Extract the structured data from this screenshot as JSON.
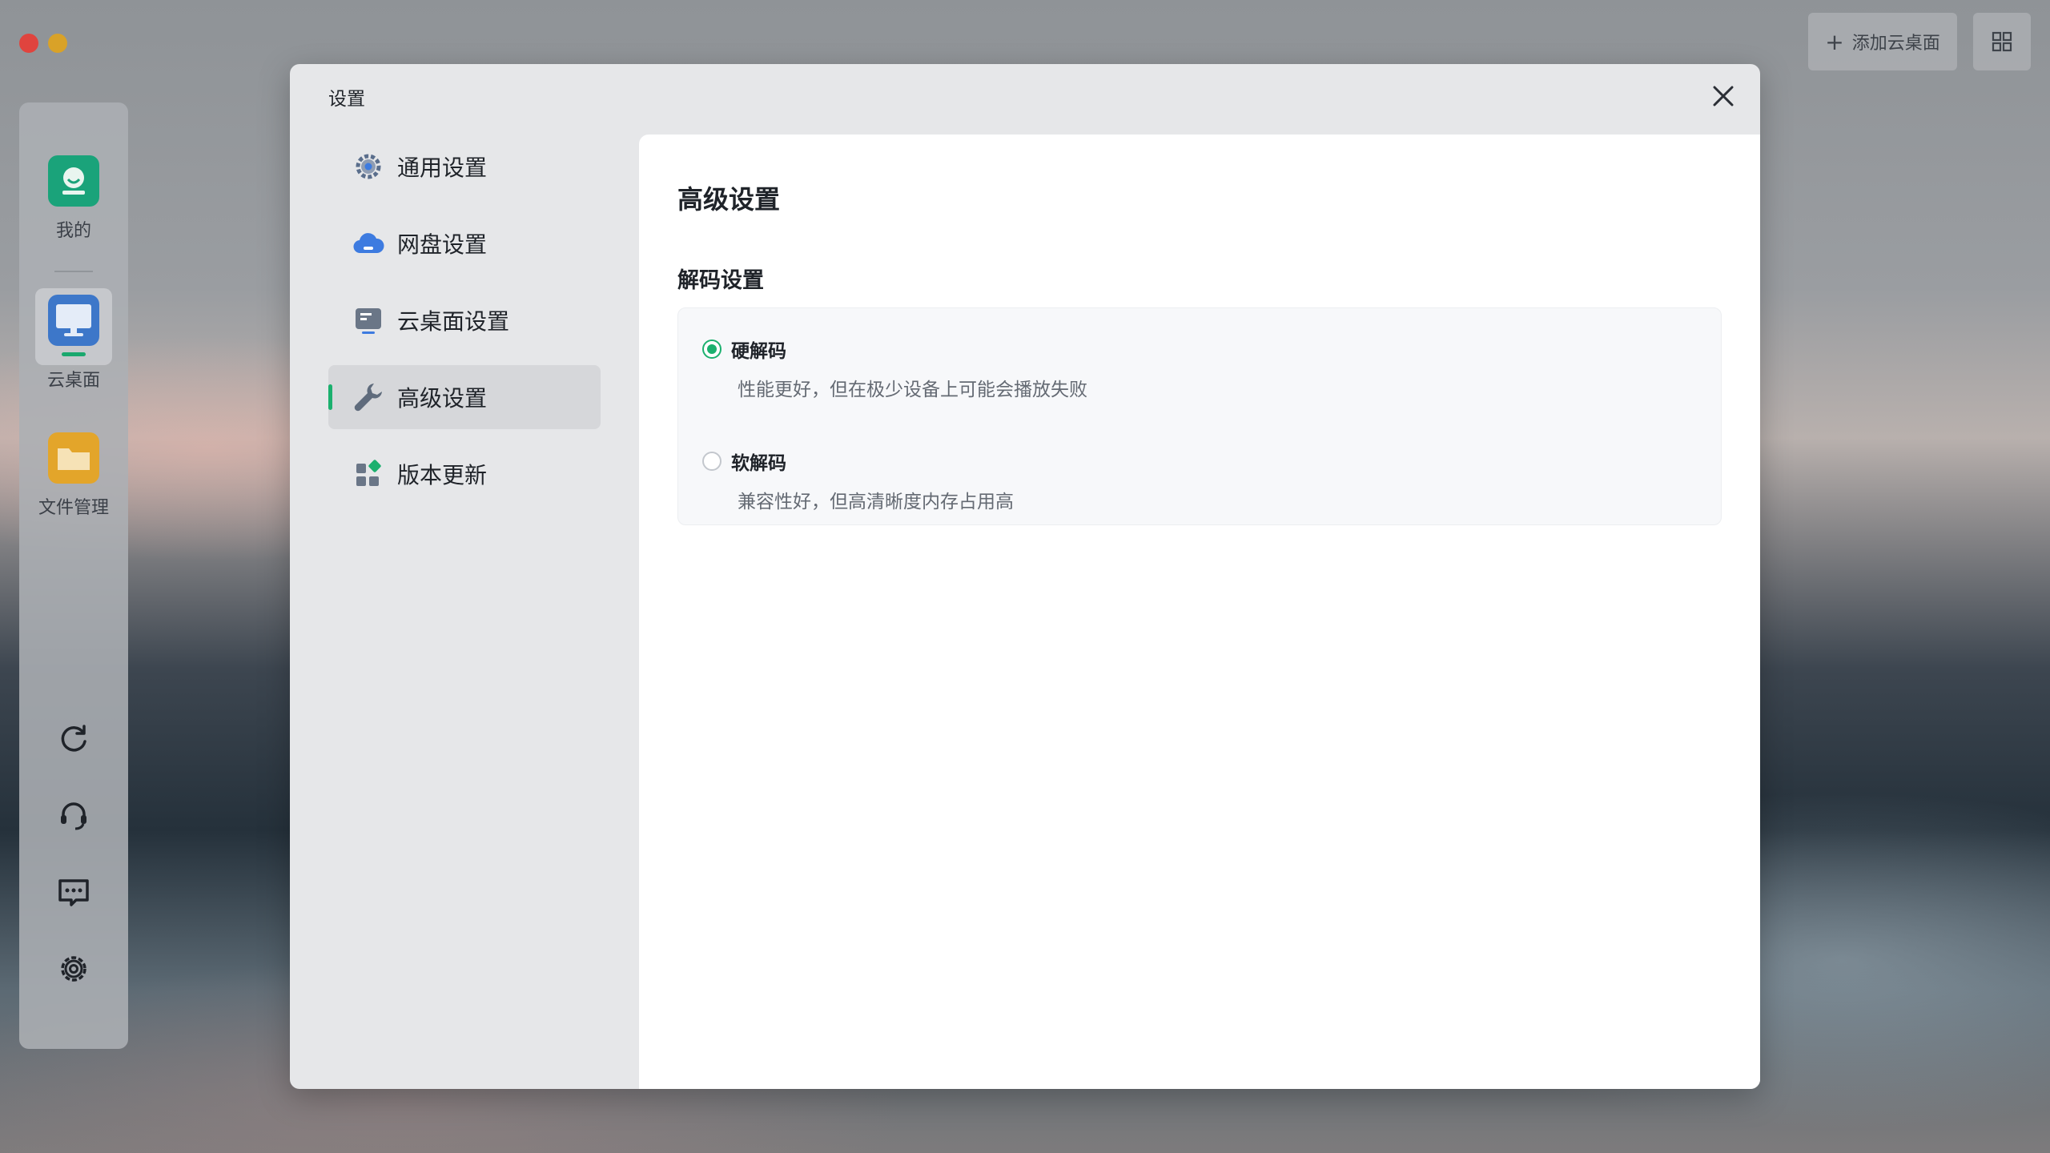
{
  "topbar": {
    "add_label": "添加云桌面",
    "add_icon": "plus-icon",
    "grid_icon": "grid-icon"
  },
  "sidebar": {
    "apps": [
      {
        "label": "我的",
        "icon": "my-app-icon"
      },
      {
        "label": "云桌面",
        "icon": "cloud-desktop-icon"
      },
      {
        "label": "文件管理",
        "icon": "folder-icon"
      }
    ],
    "bottom_icons": [
      "refresh-icon",
      "headset-icon",
      "message-icon",
      "gear-icon"
    ]
  },
  "dialog": {
    "title": "设置",
    "nav": [
      {
        "label": "通用设置",
        "icon": "gear-icon",
        "active": false
      },
      {
        "label": "网盘设置",
        "icon": "cloud-icon",
        "active": false
      },
      {
        "label": "云桌面设置",
        "icon": "desktop-icon",
        "active": false
      },
      {
        "label": "高级设置",
        "icon": "wrench-icon",
        "active": true
      },
      {
        "label": "版本更新",
        "icon": "update-icon",
        "active": false
      }
    ],
    "content": {
      "title": "高级设置",
      "section_title": "解码设置",
      "options": [
        {
          "label": "硬解码",
          "desc": "性能更好，但在极少设备上可能会播放失败",
          "checked": true
        },
        {
          "label": "软解码",
          "desc": "兼容性好，但高清晰度内存占用高",
          "checked": false
        }
      ]
    }
  },
  "colors": {
    "accent": "#1bb06e"
  }
}
